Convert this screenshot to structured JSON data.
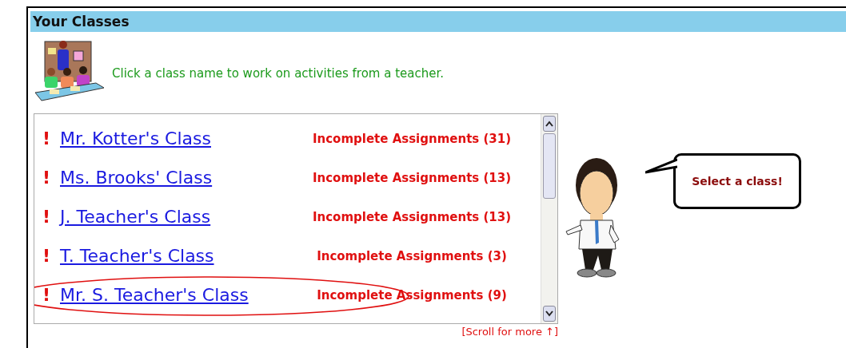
{
  "header": {
    "title": "Your Classes"
  },
  "intro": {
    "text": "Click a class name to work on activities from a teacher."
  },
  "classes": [
    {
      "alert": "!",
      "name": "Mr. Kotter's Class",
      "status": "Incomplete Assignments (31)",
      "circled": false
    },
    {
      "alert": "!",
      "name": "Ms. Brooks' Class",
      "status": "Incomplete Assignments (13)",
      "circled": false
    },
    {
      "alert": "!",
      "name": "J. Teacher's Class",
      "status": "Incomplete Assignments (13)",
      "circled": false
    },
    {
      "alert": "!",
      "name": "T. Teacher's Class",
      "status": "Incomplete Assignments (3)",
      "circled": false
    },
    {
      "alert": "!",
      "name": "Mr. S. Teacher's Class",
      "status": "Incomplete Assignments (9)",
      "circled": true
    }
  ],
  "scroll_hint": "[Scroll for more ↑]",
  "speech_bubble": {
    "text": "Select a class!"
  }
}
